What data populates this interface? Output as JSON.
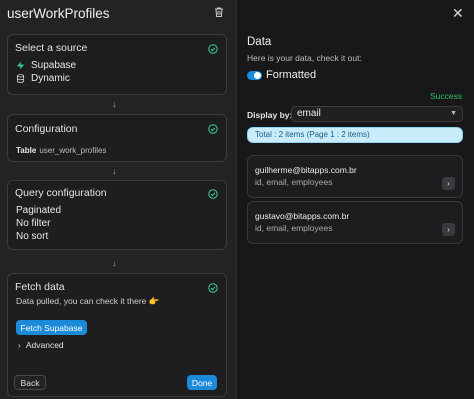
{
  "header": {
    "title": "userWorkProfiles"
  },
  "steps": {
    "source": {
      "title": "Select a source",
      "items": [
        {
          "label": "Supabase",
          "icon": "supabase-icon"
        },
        {
          "label": "Dynamic",
          "icon": "database-icon"
        }
      ]
    },
    "configuration": {
      "title": "Configuration",
      "table_label": "Table",
      "table_value": "user_work_profiles"
    },
    "query": {
      "title": "Query configuration",
      "lines": [
        "Paginated",
        "No filter",
        "No sort"
      ]
    },
    "fetch": {
      "title": "Fetch data",
      "message": "Data pulled, you can check it there 👉",
      "button": "Fetch Supabase",
      "advanced": "Advanced"
    }
  },
  "footer": {
    "back": "Back",
    "done": "Done"
  },
  "data_panel": {
    "title": "Data",
    "subtitle": "Here is your data, check it out:",
    "toggle_label": "Formatted",
    "toggle_on": true,
    "status": "Success",
    "display_by_label": "Display by:",
    "display_by_value": "email",
    "total": "Total : 2 items (Page 1 : 2 items)",
    "items": [
      {
        "title": "guilherme@bitapps.com.br",
        "fields": "id, email, employees"
      },
      {
        "title": "gustavo@bitapps.com.br",
        "fields": "id, email, employees"
      }
    ]
  },
  "colors": {
    "accent": "#1a8ad9",
    "success": "#2fbf5e",
    "check": "#3ecf8e"
  }
}
